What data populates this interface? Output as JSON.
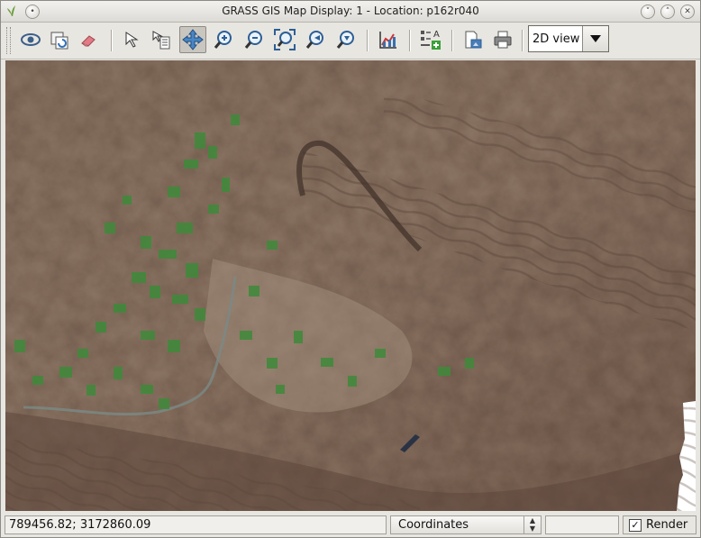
{
  "window": {
    "title": "GRASS GIS Map Display: 1  - Location: p162r040",
    "controls": [
      "minimize",
      "maximize",
      "close"
    ]
  },
  "toolbar": {
    "tools": [
      {
        "name": "display-map-icon",
        "tooltip": "Display map"
      },
      {
        "name": "render-map-icon",
        "tooltip": "Render map"
      },
      {
        "name": "erase-icon",
        "tooltip": "Erase display"
      },
      {
        "name": "pointer-icon",
        "tooltip": "Pointer"
      },
      {
        "name": "query-icon",
        "tooltip": "Query raster/vector map(s)"
      },
      {
        "name": "pan-icon",
        "tooltip": "Pan",
        "active": true
      },
      {
        "name": "zoom-in-icon",
        "tooltip": "Zoom in"
      },
      {
        "name": "zoom-out-icon",
        "tooltip": "Zoom out"
      },
      {
        "name": "zoom-extent-icon",
        "tooltip": "Zoom to selected map layer(s)"
      },
      {
        "name": "zoom-back-icon",
        "tooltip": "Return to previous zoom"
      },
      {
        "name": "zoom-menu-icon",
        "tooltip": "Zoom options"
      },
      {
        "name": "analyze-icon",
        "tooltip": "Analyze map"
      },
      {
        "name": "overlay-icon",
        "tooltip": "Add map elements"
      },
      {
        "name": "save-image-icon",
        "tooltip": "Save display to graphic file"
      },
      {
        "name": "print-icon",
        "tooltip": "Print display"
      }
    ],
    "view_mode": "2D view"
  },
  "statusbar": {
    "coordinates": "789456.82; 3172860.09",
    "mode": "Coordinates",
    "render_label": "Render",
    "render_checked": true
  },
  "colors": {
    "terrain": "#7d6556",
    "vegetation": "#3e8a3a",
    "selected_tool": "#c9c6bf"
  }
}
